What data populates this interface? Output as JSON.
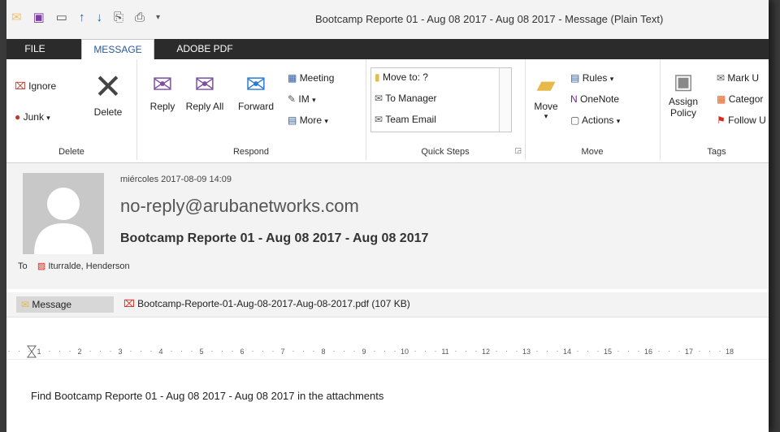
{
  "window": {
    "title": "Bootcamp Reporte 01 - Aug 08 2017 - Aug 08 2017 - Message (Plain Text)"
  },
  "qat": {
    "icons": [
      "mail-icon",
      "save-icon",
      "reply-icon",
      "up-arrow-icon",
      "down-arrow-icon",
      "copy-icon",
      "print-icon",
      "customize-icon"
    ]
  },
  "tabs": [
    {
      "label": "FILE"
    },
    {
      "label": "MESSAGE"
    },
    {
      "label": "ADOBE PDF"
    }
  ],
  "ribbon": {
    "delete_group": {
      "label": "Delete",
      "ignore": "Ignore",
      "junk": "Junk",
      "delete": "Delete"
    },
    "respond_group": {
      "label": "Respond",
      "reply": "Reply",
      "reply_all": "Reply All",
      "forward": "Forward",
      "meeting": "Meeting",
      "im": "IM",
      "more": "More"
    },
    "quick_steps_group": {
      "label": "Quick Steps",
      "items": [
        "Move to: ?",
        "To Manager",
        "Team Email"
      ]
    },
    "move_group": {
      "label": "Move",
      "move": "Move",
      "rules": "Rules",
      "onenote": "OneNote",
      "actions": "Actions"
    },
    "tags_group": {
      "label": "Tags",
      "assign_policy": "Assign Policy",
      "mark": "Mark U",
      "category": "Categor",
      "follow": "Follow U"
    }
  },
  "header": {
    "date": "miércoles 2017-08-09 14:09",
    "from": "no-reply@arubanetworks.com",
    "subject": "Bootcamp Reporte 01 - Aug 08 2017 - Aug 08 2017",
    "to_label": "To",
    "to_name": "Iturralde, Henderson"
  },
  "attachments": {
    "message_tab": "Message",
    "file": "Bootcamp-Reporte-01-Aug-08-2017-Aug-08-2017.pdf (107 KB)"
  },
  "ruler": {
    "ticks": [
      "1",
      "2",
      "3",
      "4",
      "5",
      "6",
      "7",
      "8",
      "9",
      "10",
      "11",
      "12",
      "13",
      "14",
      "15",
      "16",
      "17",
      "18"
    ]
  },
  "body": {
    "text": "Find Bootcamp Reporte 01 - Aug 08 2017 - Aug 08 2017 in the attachments"
  },
  "colors": {
    "accent": "#2b579a",
    "dark_tabbar": "#2b2b2b",
    "header_bg": "#f3f3f3"
  }
}
